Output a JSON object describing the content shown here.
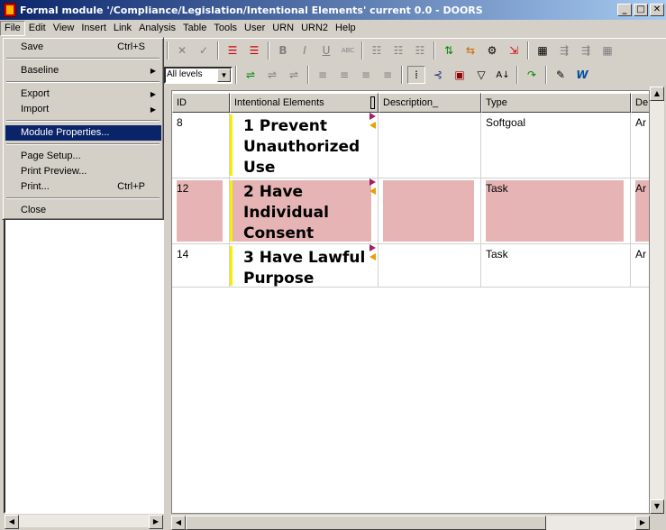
{
  "window": {
    "title": "Formal module '/Compliance/Legislation/Intentional Elements' current 0.0 - DOORS"
  },
  "menubar": [
    "File",
    "Edit",
    "View",
    "Insert",
    "Link",
    "Analysis",
    "Table",
    "Tools",
    "User",
    "URN",
    "URN2",
    "Help"
  ],
  "file_menu": {
    "save": {
      "label": "Save",
      "shortcut": "Ctrl+S"
    },
    "baseline": {
      "label": "Baseline"
    },
    "export": {
      "label": "Export"
    },
    "import": {
      "label": "Import"
    },
    "module_properties": {
      "label": "Module Properties..."
    },
    "page_setup": {
      "label": "Page Setup..."
    },
    "print_preview": {
      "label": "Print Preview..."
    },
    "print": {
      "label": "Print...",
      "shortcut": "Ctrl+P"
    },
    "close": {
      "label": "Close"
    }
  },
  "toolbar": {
    "levels_value": "All levels"
  },
  "grid": {
    "columns": [
      "ID",
      "Intentional Elements",
      "Description_",
      "Type",
      "De"
    ],
    "rows": [
      {
        "id": "8",
        "heading": "1 Prevent Unauthorized Use",
        "description": "",
        "type": "Softgoal",
        "extra": "Ar",
        "highlight": false
      },
      {
        "id": "12",
        "heading": "2 Have Individual Consent",
        "description": "",
        "type": "Task",
        "extra": "Ar",
        "highlight": true
      },
      {
        "id": "14",
        "heading": "3 Have Lawful Purpose",
        "description": "",
        "type": "Task",
        "extra": "Ar",
        "highlight": false
      }
    ]
  },
  "colors": {
    "highlight": "#e6b4b4",
    "selection": "#0a246a",
    "heading_bar": "#f6f000"
  }
}
